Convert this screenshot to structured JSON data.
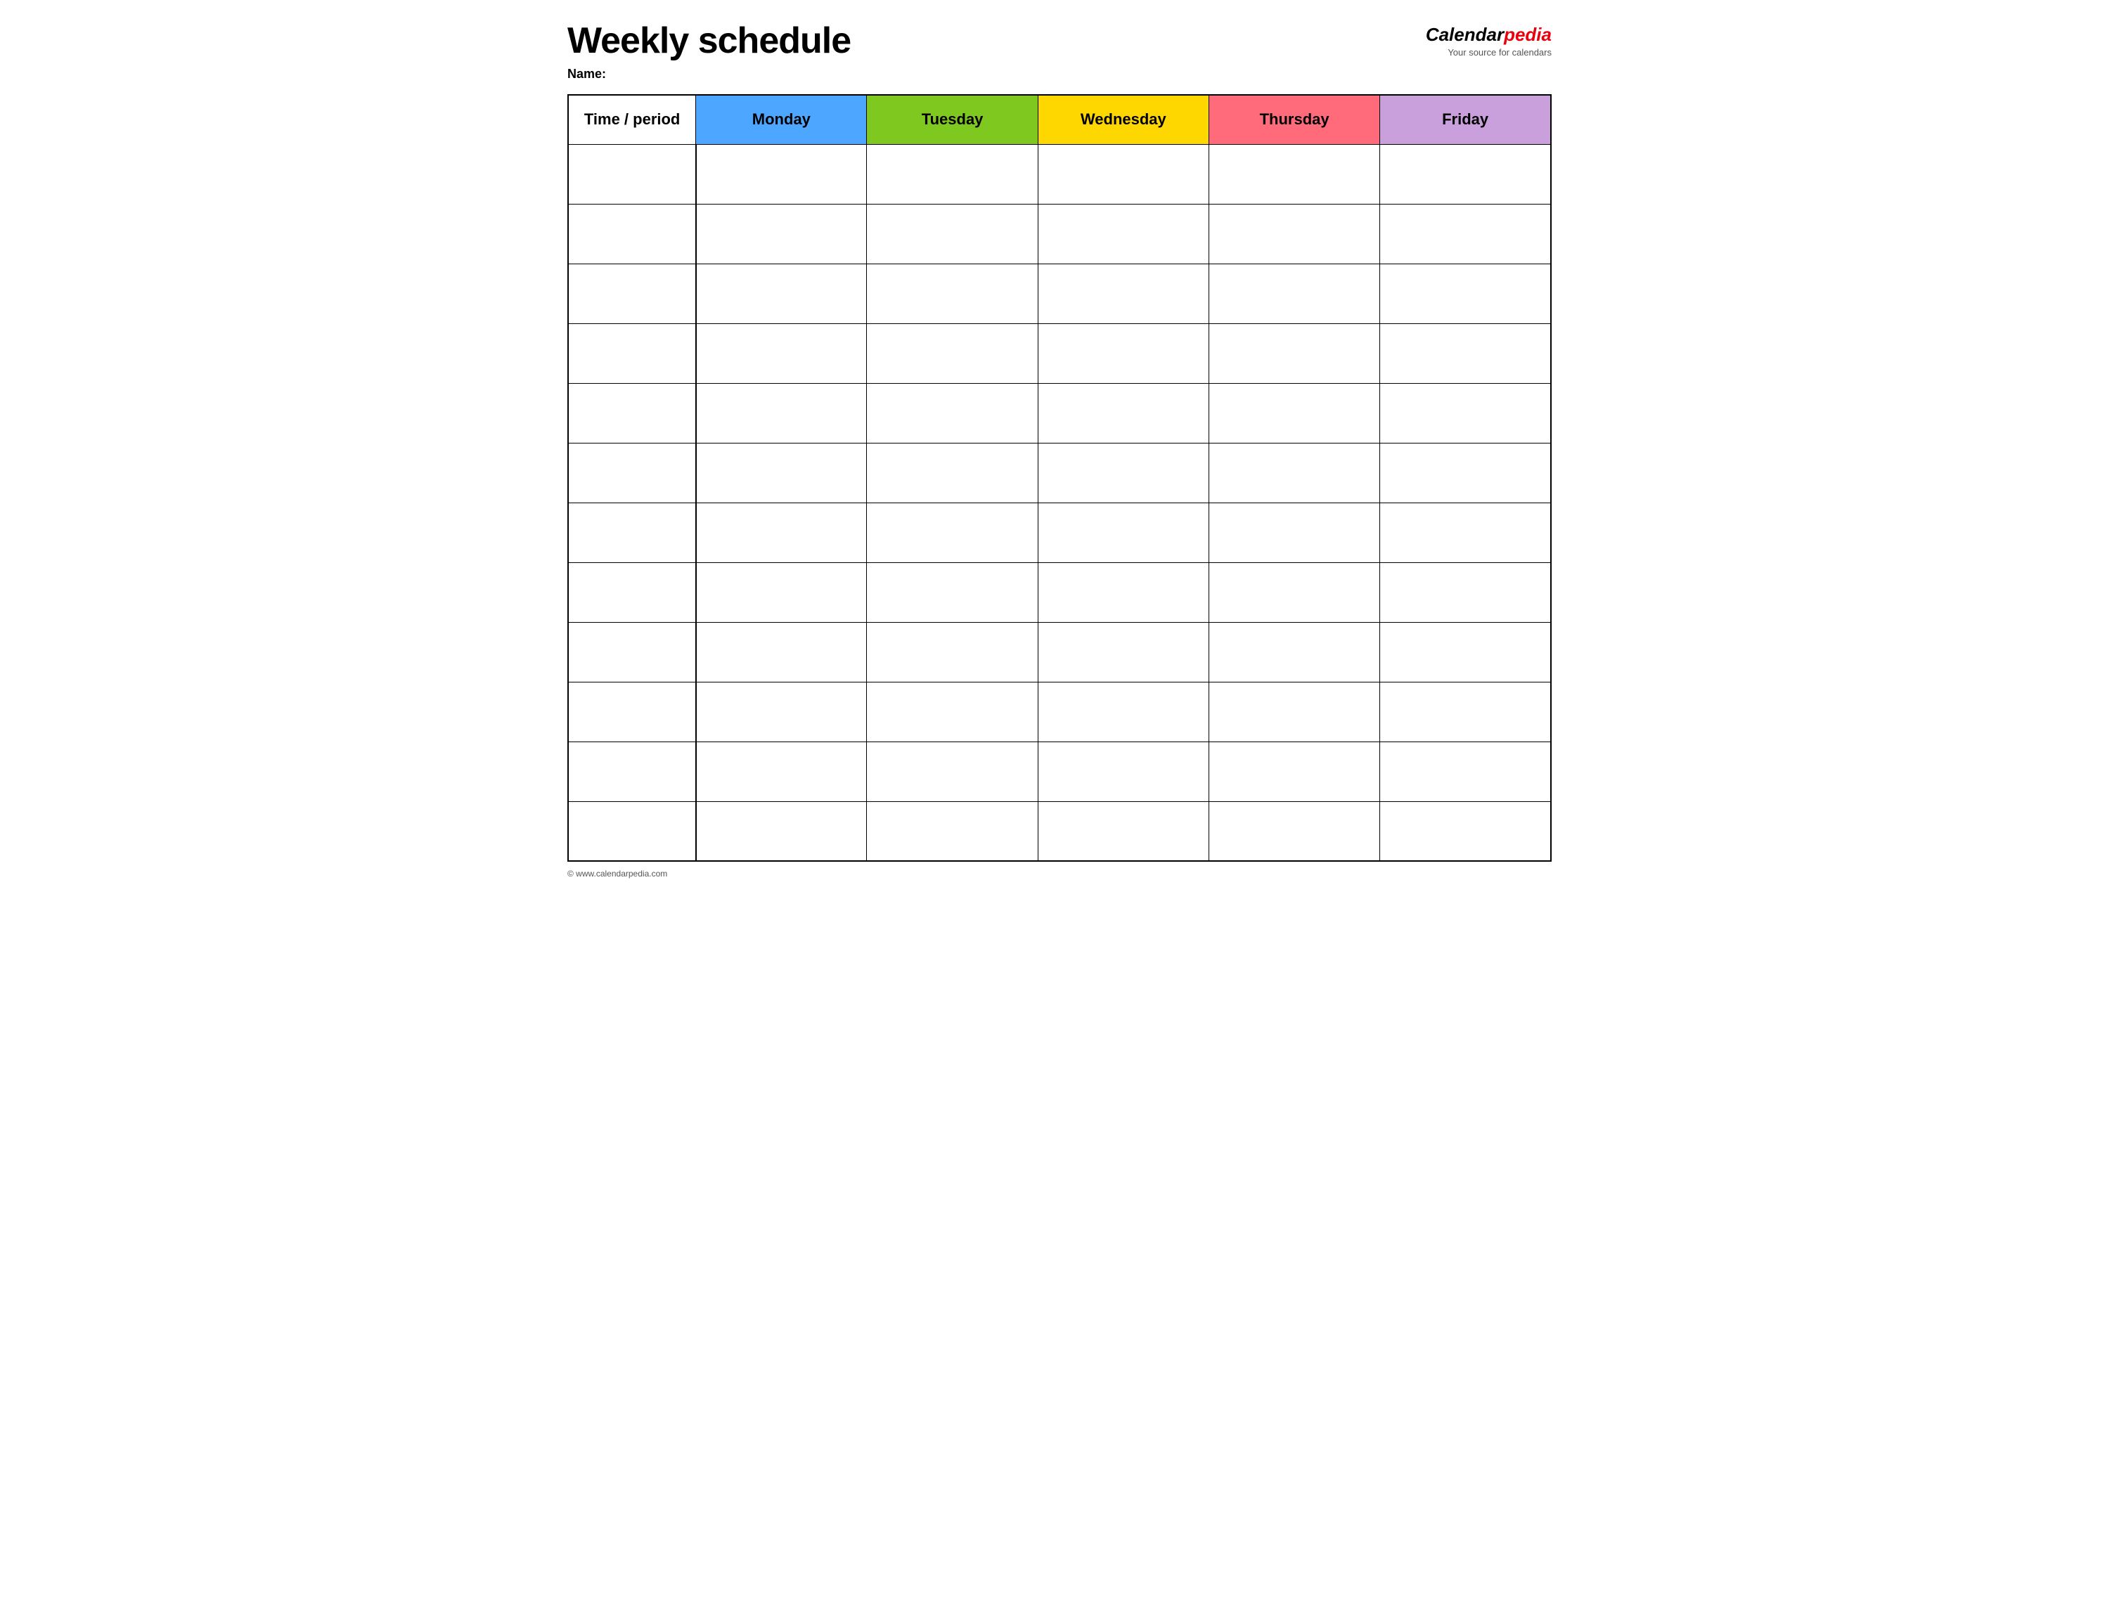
{
  "header": {
    "title": "Weekly schedule",
    "name_label": "Name:",
    "logo_calendar": "Calendar",
    "logo_pedia": "pedia",
    "logo_tagline": "Your source for calendars"
  },
  "table": {
    "headers": [
      {
        "id": "time",
        "label": "Time / period",
        "color": "#ffffff"
      },
      {
        "id": "monday",
        "label": "Monday",
        "color": "#4da6ff"
      },
      {
        "id": "tuesday",
        "label": "Tuesday",
        "color": "#7ec820"
      },
      {
        "id": "wednesday",
        "label": "Wednesday",
        "color": "#ffd700"
      },
      {
        "id": "thursday",
        "label": "Thursday",
        "color": "#ff6b7a"
      },
      {
        "id": "friday",
        "label": "Friday",
        "color": "#c9a0dc"
      }
    ],
    "row_count": 12
  },
  "footer": {
    "text": "© www.calendarpedia.com"
  }
}
